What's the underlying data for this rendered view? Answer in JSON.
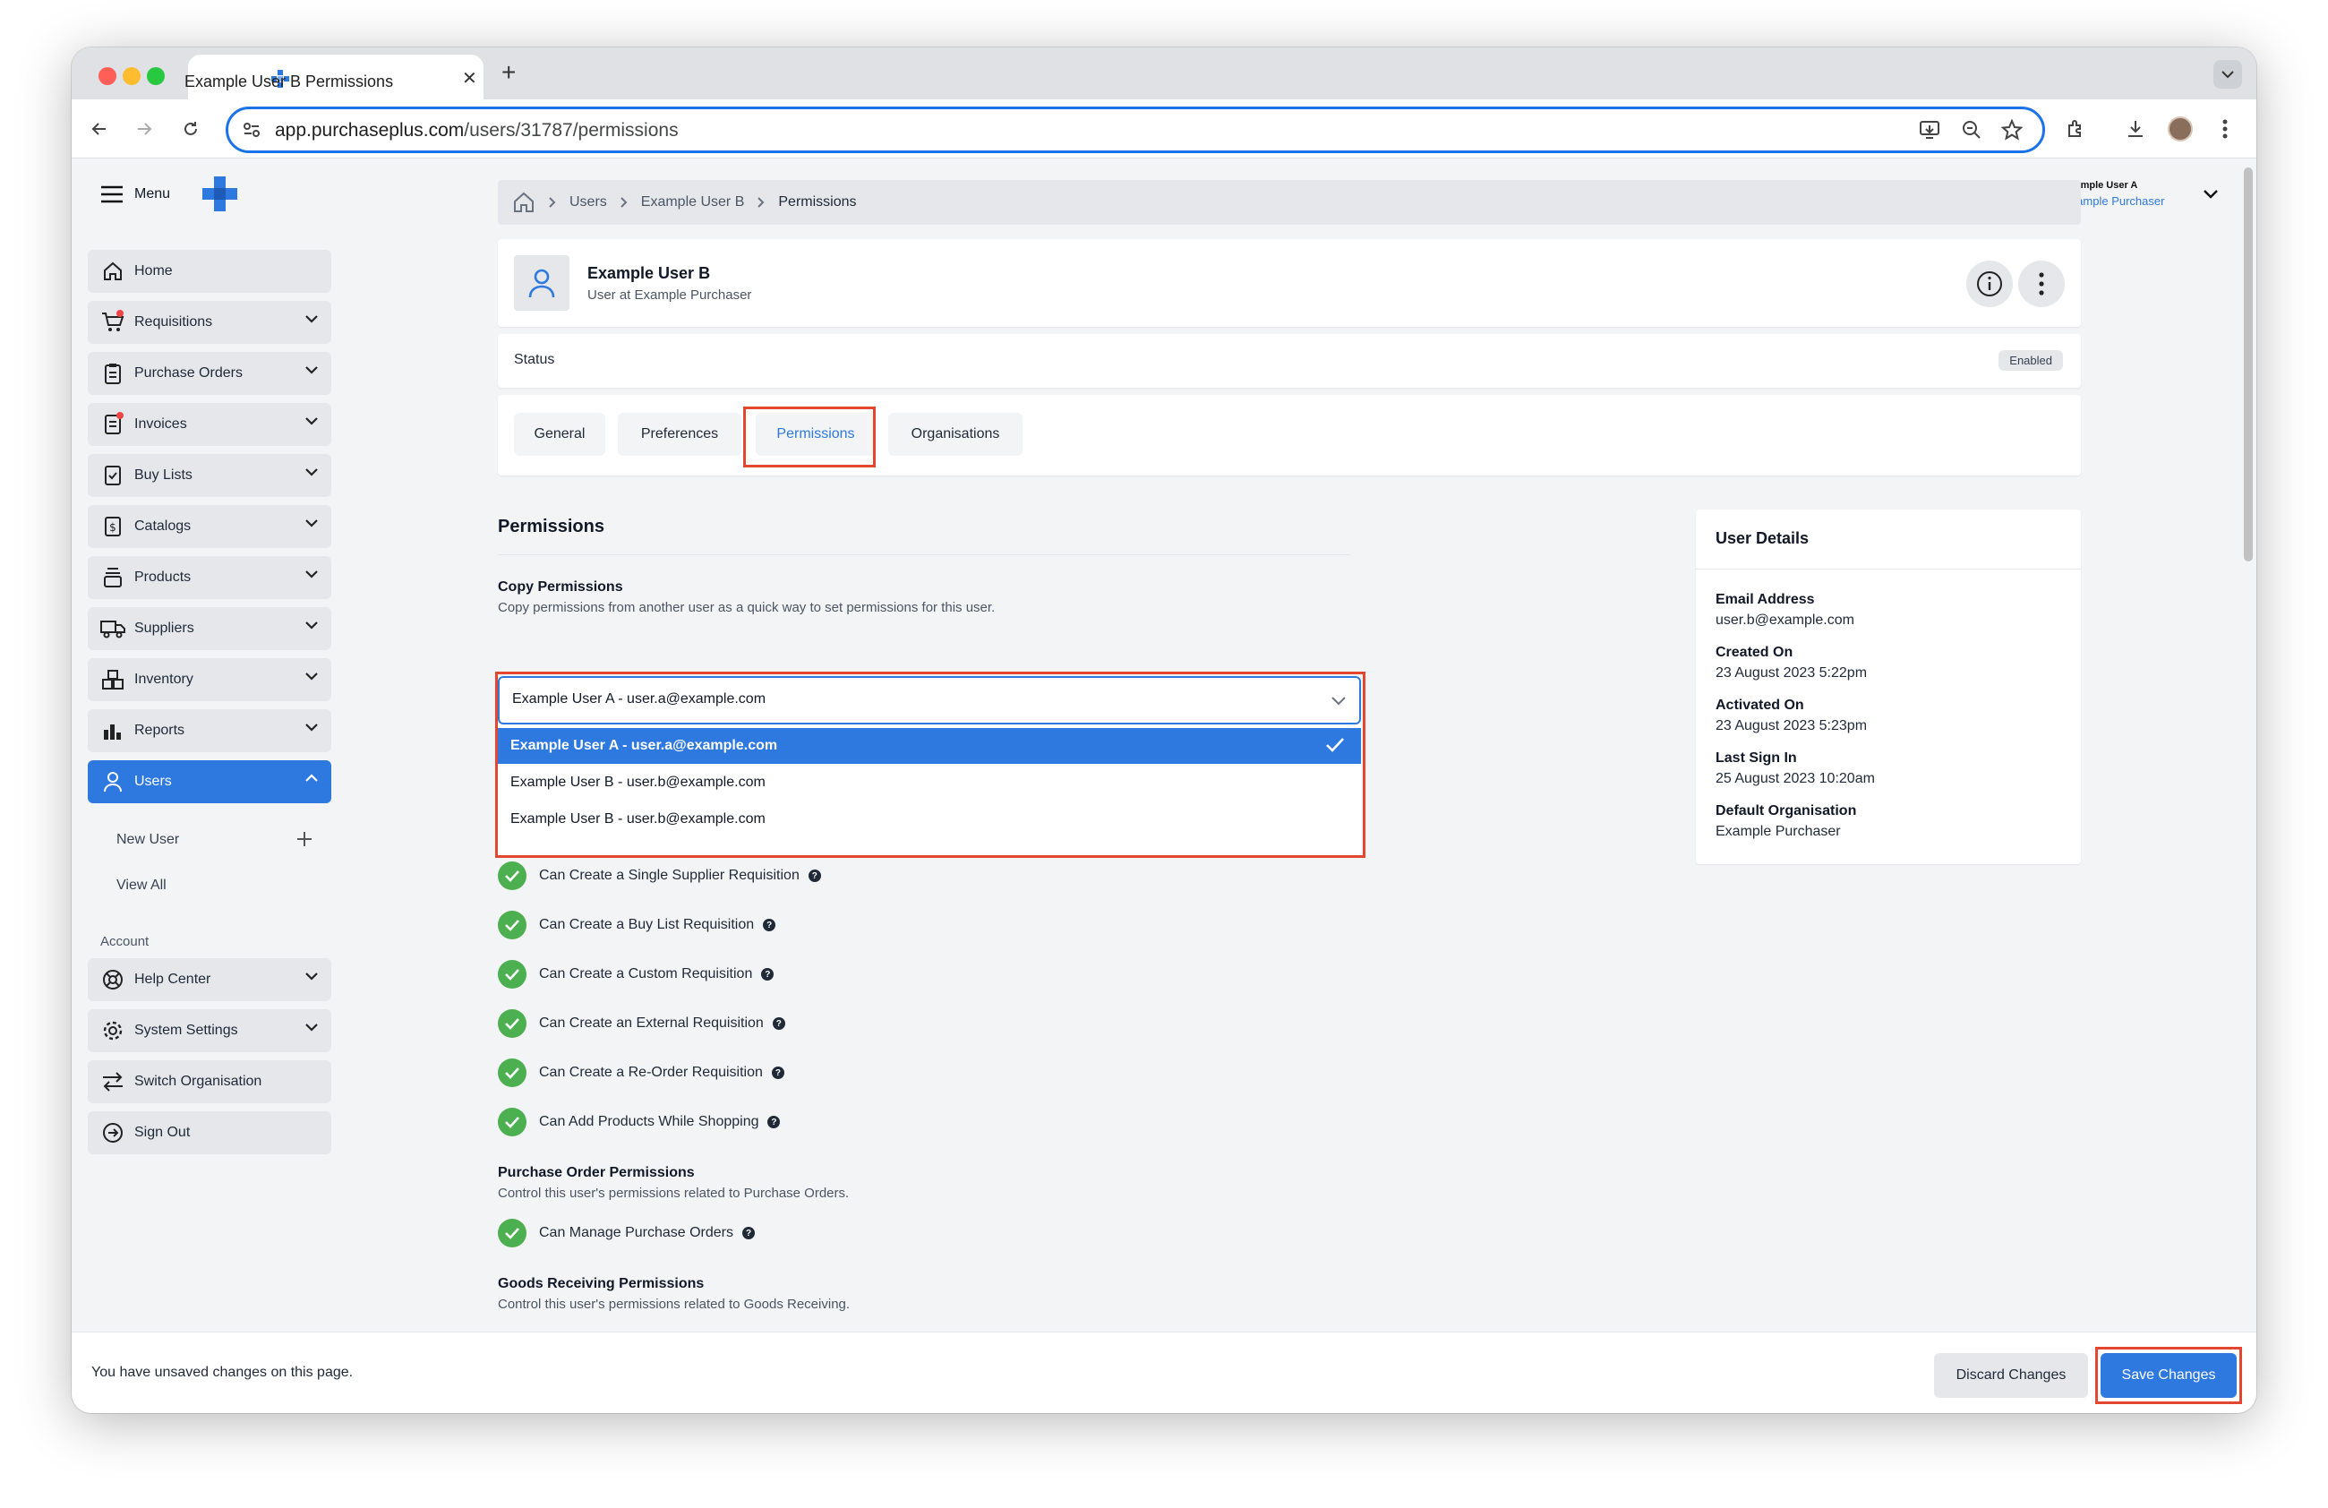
{
  "browser": {
    "tab_title": "Example User B Permissions",
    "new_tab": "+",
    "url_domain": "app.purchaseplus.com",
    "url_path": "/users/31787/permissions"
  },
  "header": {
    "menu_label": "Menu",
    "user_name": "Example User A",
    "user_org": "Example Purchaser"
  },
  "sidebar": {
    "items": [
      {
        "label": "Home"
      },
      {
        "label": "Requisitions"
      },
      {
        "label": "Purchase Orders"
      },
      {
        "label": "Invoices"
      },
      {
        "label": "Buy Lists"
      },
      {
        "label": "Catalogs"
      },
      {
        "label": "Products"
      },
      {
        "label": "Suppliers"
      },
      {
        "label": "Inventory"
      },
      {
        "label": "Reports"
      },
      {
        "label": "Users"
      }
    ],
    "users_sub": {
      "new_user": "New User",
      "view_all": "View All"
    },
    "account_label": "Account",
    "account_items": [
      {
        "label": "Help Center"
      },
      {
        "label": "System Settings"
      },
      {
        "label": "Switch Organisation"
      },
      {
        "label": "Sign Out"
      }
    ]
  },
  "breadcrumb": {
    "users": "Users",
    "user": "Example User B",
    "current": "Permissions"
  },
  "profile": {
    "name": "Example User B",
    "subtitle": "User at Example Purchaser"
  },
  "status": {
    "label": "Status",
    "value": "Enabled"
  },
  "tabs": {
    "general": "General",
    "preferences": "Preferences",
    "permissions": "Permissions",
    "organisations": "Organisations"
  },
  "permissions": {
    "title": "Permissions",
    "copy_title": "Copy Permissions",
    "copy_desc": "Copy permissions from another user as a quick way to set permissions for this user.",
    "copy_value": "Example User A - user.a@example.com",
    "options": [
      "Example User A - user.a@example.com",
      "Example User B - user.b@example.com",
      "Example User B - user.b@example.com"
    ],
    "requisition_perms": [
      "Can Create a Single Supplier Requisition",
      "Can Create a Buy List Requisition",
      "Can Create a Custom Requisition",
      "Can Create an External Requisition",
      "Can Create a Re-Order Requisition",
      "Can Add Products While Shopping"
    ],
    "po_title": "Purchase Order Permissions",
    "po_desc": "Control this user's permissions related to Purchase Orders.",
    "po_perms": [
      "Can Manage Purchase Orders"
    ],
    "gr_title": "Goods Receiving Permissions",
    "gr_desc": "Control this user's permissions related to Goods Receiving."
  },
  "details": {
    "title": "User Details",
    "email_label": "Email Address",
    "email": "user.b@example.com",
    "created_label": "Created On",
    "created": "23 August 2023 5:22pm",
    "activated_label": "Activated On",
    "activated": "23 August 2023 5:23pm",
    "signin_label": "Last Sign In",
    "signin": "25 August 2023 10:20am",
    "org_label": "Default Organisation",
    "org": "Example Purchaser"
  },
  "footer": {
    "message": "You have unsaved changes on this page.",
    "discard": "Discard Changes",
    "save": "Save Changes"
  },
  "colors": {
    "accent": "#2e79e0",
    "highlight": "#e4472f",
    "success": "#4caf50"
  }
}
